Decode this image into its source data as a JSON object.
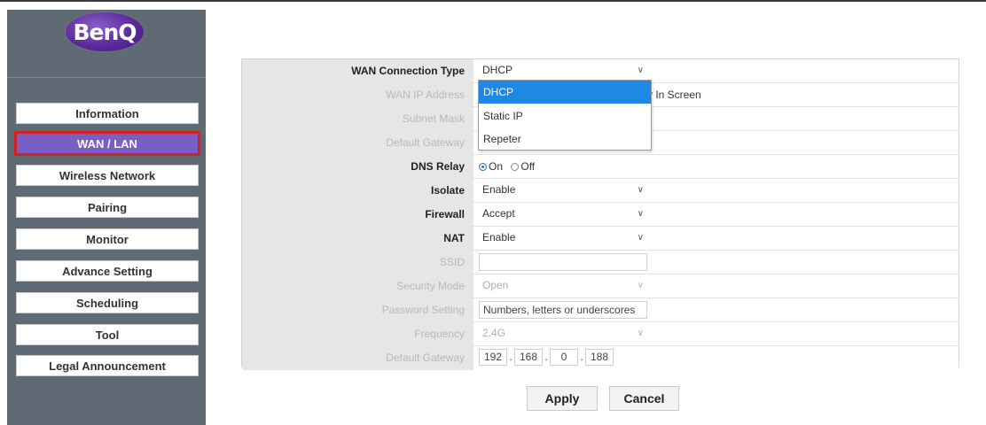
{
  "brand": {
    "logo_text": "BenQ",
    "accent": "#7b5ec4",
    "highlight_border": "#d42020"
  },
  "sidebar": {
    "items": [
      {
        "label": "Information"
      },
      {
        "label": "WAN / LAN",
        "active": true
      },
      {
        "label": "Wireless Network"
      },
      {
        "label": "Pairing"
      },
      {
        "label": "Monitor"
      },
      {
        "label": "Advance Setting"
      },
      {
        "label": "Scheduling"
      },
      {
        "label": "Tool"
      },
      {
        "label": "Legal Announcement"
      }
    ]
  },
  "form": {
    "wan_connection_type": {
      "label": "WAN Connection Type",
      "value": "DHCP"
    },
    "wan_ip": {
      "label": "WAN IP Address",
      "value_suffix": "y In Screen"
    },
    "subnet_mask": {
      "label": "Subnet Mask"
    },
    "default_gateway_1": {
      "label": "Default Gateway"
    },
    "dns_relay": {
      "label": "DNS Relay",
      "on": "On",
      "off": "Off",
      "selected": "On"
    },
    "isolate": {
      "label": "Isolate",
      "value": "Enable"
    },
    "firewall": {
      "label": "Firewall",
      "value": "Accept"
    },
    "nat": {
      "label": "NAT",
      "value": "Enable"
    },
    "ssid": {
      "label": "SSID",
      "value": ""
    },
    "security_mode": {
      "label": "Security Mode",
      "value": "Open"
    },
    "password": {
      "label": "Password Setting",
      "placeholder": "Numbers, letters or underscores"
    },
    "frequency": {
      "label": "Frequency",
      "value": "2.4G"
    },
    "default_gateway_2": {
      "label": "Default Gateway",
      "ip": [
        "192",
        "168",
        "0",
        "188"
      ]
    }
  },
  "dropdown": {
    "options": [
      "DHCP",
      "Static IP",
      "Repeter"
    ],
    "highlighted": "DHCP"
  },
  "buttons": {
    "apply": "Apply",
    "cancel": "Cancel"
  }
}
